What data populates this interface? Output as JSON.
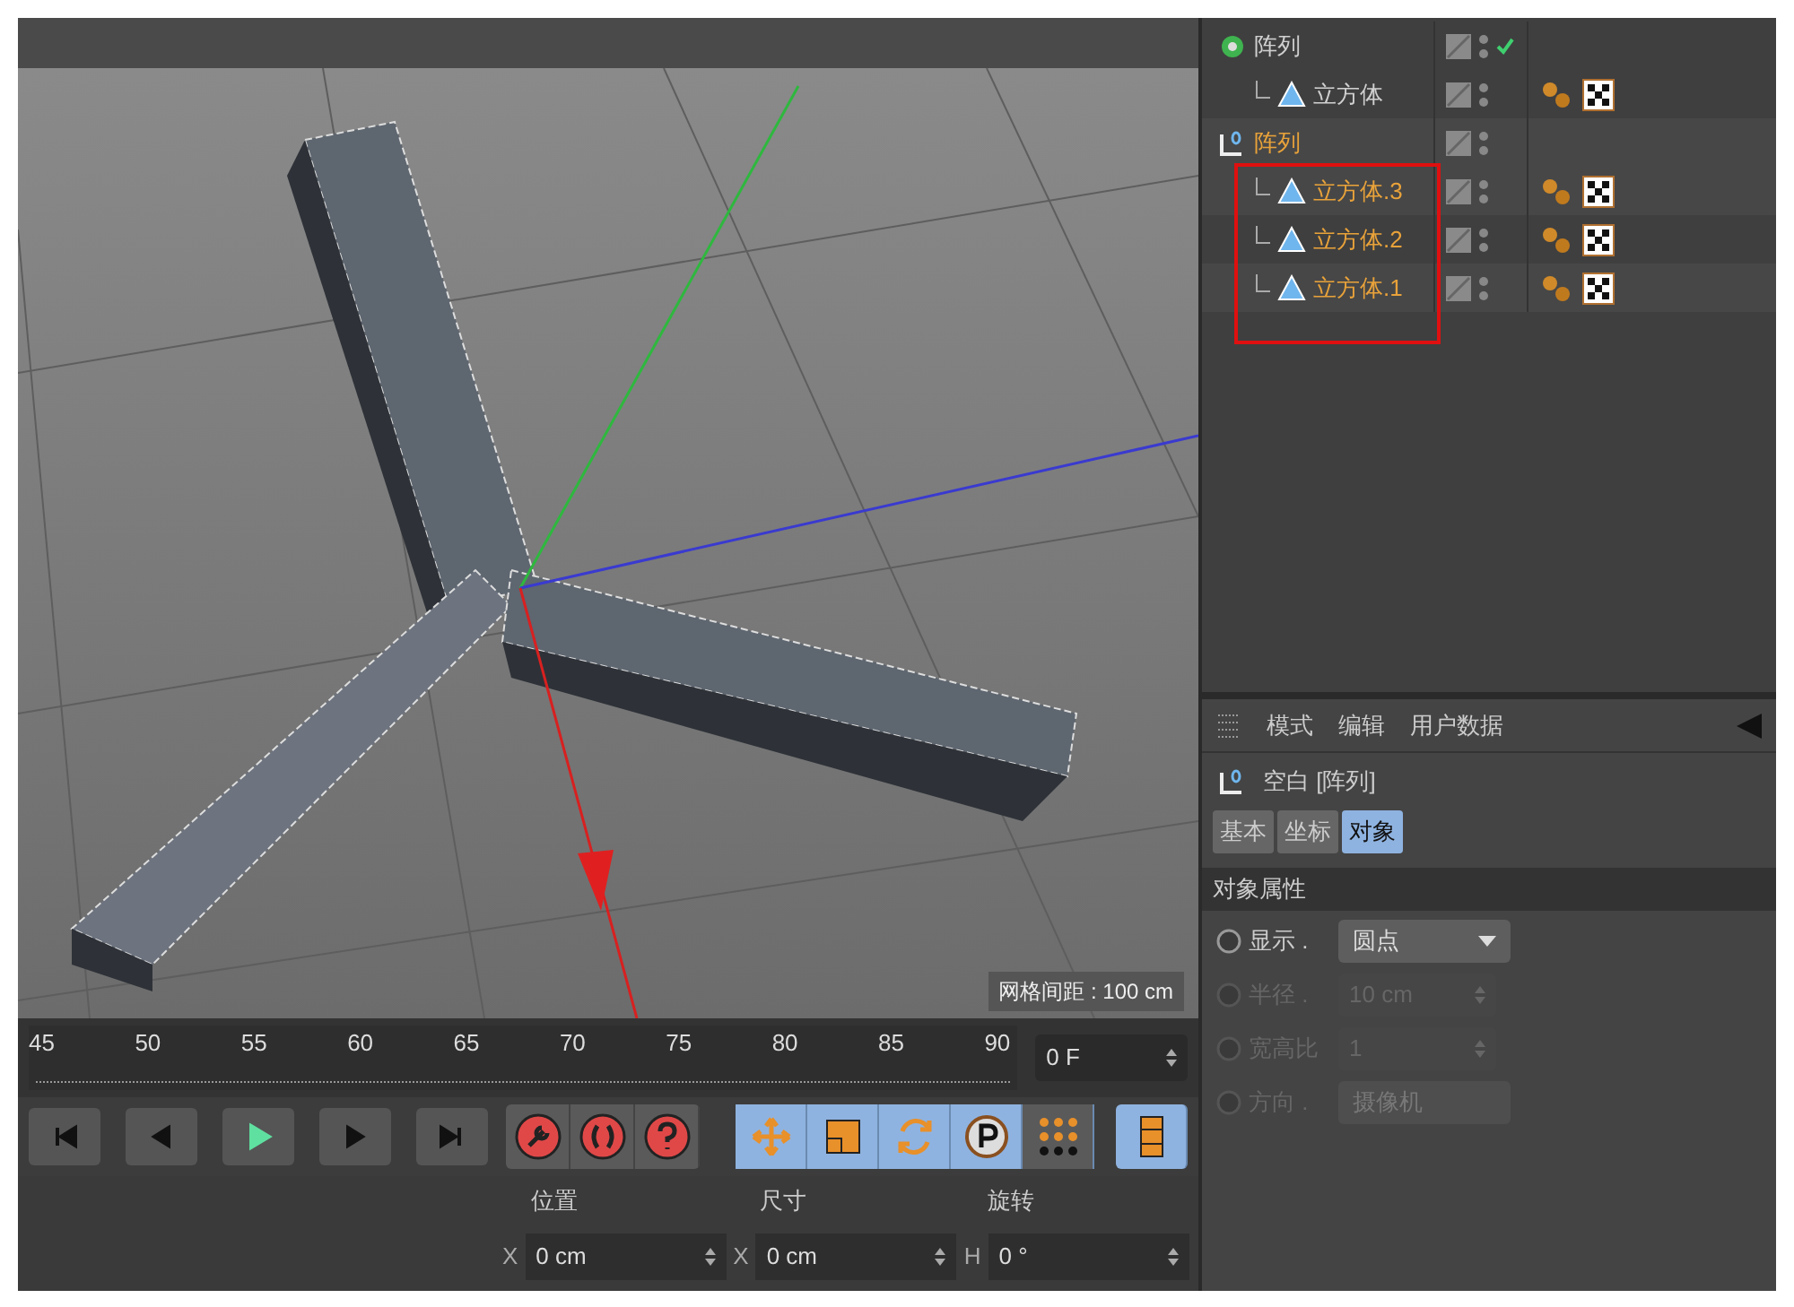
{
  "viewport": {
    "grid_label": "网格间距 : 100 cm"
  },
  "objects": [
    {
      "kind": "cloner",
      "name": "阵列",
      "selected": false,
      "checked": true,
      "highlighted": false,
      "children": [
        {
          "kind": "cube",
          "name": "立方体",
          "selected": false,
          "checked": false,
          "highlighted": false,
          "tags": [
            {
              "kind": "phong"
            },
            {
              "kind": "material"
            }
          ]
        }
      ]
    },
    {
      "kind": "null",
      "name": "阵列",
      "selected": true,
      "checked": false,
      "highlighted": true,
      "children": [
        {
          "kind": "cube",
          "name": "立方体.3",
          "selected": true,
          "checked": false,
          "highlighted": false,
          "tags": [
            {
              "kind": "phong"
            },
            {
              "kind": "material"
            }
          ]
        },
        {
          "kind": "cube",
          "name": "立方体.2",
          "selected": true,
          "checked": false,
          "highlighted": false,
          "tags": [
            {
              "kind": "phong"
            },
            {
              "kind": "material"
            }
          ]
        },
        {
          "kind": "cube",
          "name": "立方体.1",
          "selected": true,
          "checked": false,
          "highlighted": false,
          "tags": [
            {
              "kind": "phong"
            },
            {
              "kind": "material"
            }
          ]
        }
      ]
    }
  ],
  "attributes": {
    "menu": [
      "模式",
      "编辑",
      "用户数据"
    ],
    "title": "空白 [阵列]",
    "tabs": [
      {
        "label": "基本",
        "selected": false
      },
      {
        "label": "坐标",
        "selected": false
      },
      {
        "label": "对象",
        "selected": true
      }
    ],
    "section": "对象属性",
    "fields": [
      {
        "kind": "dropdown",
        "label": "显示 .",
        "value": "圆点",
        "disabled": false
      },
      {
        "kind": "spinner",
        "label": "半径 .",
        "value": "10 cm",
        "disabled": true
      },
      {
        "kind": "spinner",
        "label": "宽高比",
        "value": "1",
        "disabled": true
      },
      {
        "kind": "dropdown",
        "label": "方向 .",
        "value": "摄像机",
        "disabled": true
      }
    ]
  },
  "timeline": {
    "ticks": [
      "45",
      "50",
      "55",
      "60",
      "65",
      "70",
      "75",
      "80",
      "85",
      "90"
    ],
    "frame": "0 F"
  },
  "playback": [
    {
      "kind": "start"
    },
    {
      "kind": "prev"
    },
    {
      "kind": "play"
    },
    {
      "kind": "next"
    },
    {
      "kind": "end"
    }
  ],
  "record": [
    {
      "kind": "key"
    },
    {
      "kind": "autokey"
    },
    {
      "kind": "help"
    }
  ],
  "tools": [
    {
      "kind": "move",
      "selected": true
    },
    {
      "kind": "scale",
      "selected": true
    },
    {
      "kind": "rotate",
      "selected": true
    },
    {
      "kind": "parameter",
      "selected": true
    },
    {
      "kind": "points",
      "selected": false
    },
    {
      "kind": "film",
      "selected": true
    }
  ],
  "coordinates": {
    "headers": [
      "位置",
      "尺寸",
      "旋转"
    ],
    "fields": [
      {
        "axis": "X",
        "value": "0 cm"
      },
      {
        "axis": "X",
        "value": "0 cm"
      },
      {
        "axis": "H",
        "value": "0 °"
      }
    ]
  }
}
